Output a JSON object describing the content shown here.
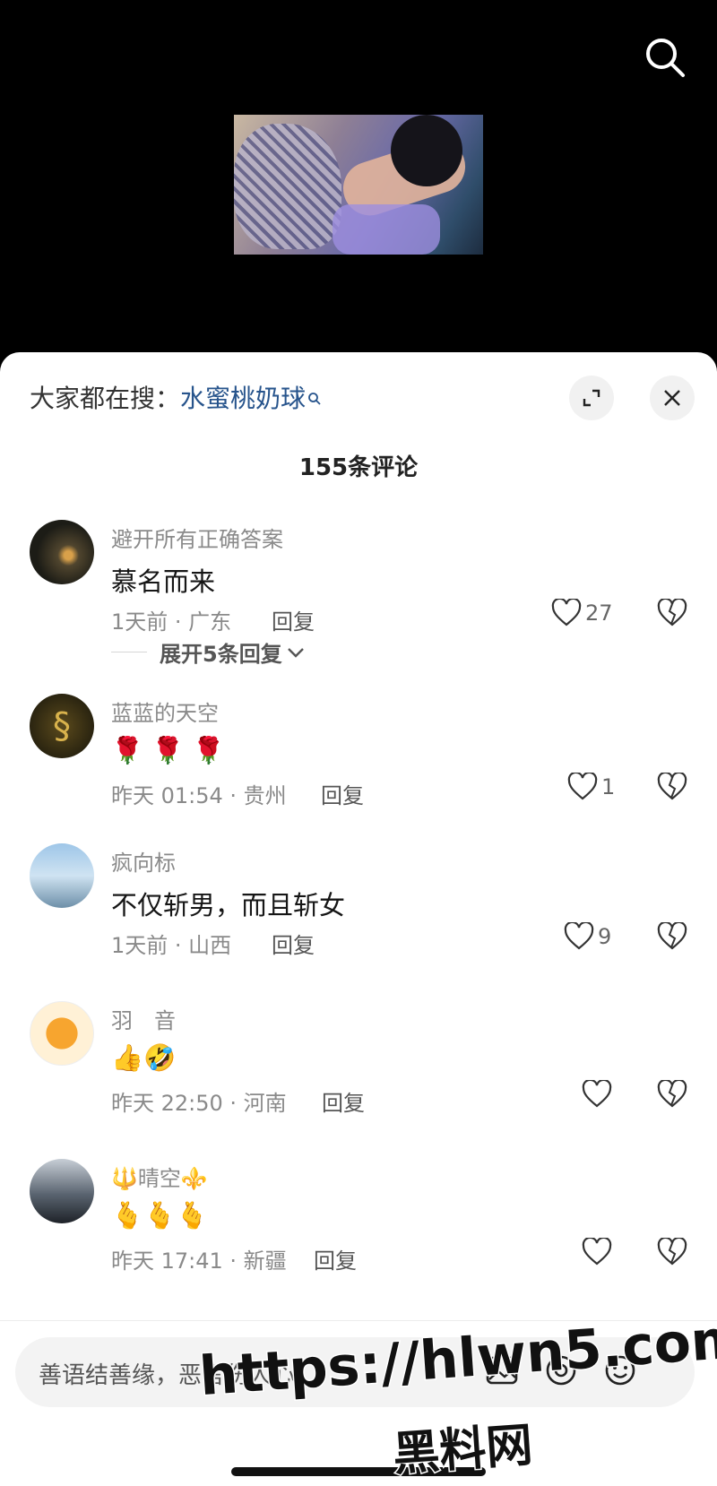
{
  "hot_search": {
    "prefix": "大家都在搜：",
    "keyword": "水蜜桃奶球"
  },
  "comment_count": "155条评论",
  "comments": [
    {
      "name": "避开所有正确答案",
      "text": "慕名而来",
      "time": "1天前 · 广东",
      "reply": "回复",
      "likes": "27"
    },
    {
      "name": "蓝蓝的天空",
      "text": "🌹 🌹 🌹",
      "time": "昨天 01:54 · 贵州",
      "reply": "回复",
      "likes": "1"
    },
    {
      "name": "疯向标",
      "text": "不仅斩男，而且斩女",
      "time": "1天前 · 山西",
      "reply": "回复",
      "likes": "9"
    },
    {
      "name": "羽　音",
      "text": "👍🤣",
      "time": "昨天 22:50 · 河南",
      "reply": "回复",
      "likes": ""
    },
    {
      "name": "🔱晴空⚜️",
      "text": "🫰🫰🫰",
      "time": "昨天 17:41 · 新疆",
      "reply": "回复",
      "likes": ""
    }
  ],
  "expand_replies": "展开5条回复",
  "input": {
    "placeholder": "善语结善缘，恶言伤人心"
  },
  "watermark": {
    "url": "https://hlwn5.com",
    "name": "黑料网"
  },
  "colors": {
    "keyword": "#27548c",
    "sheet": "#ffffff",
    "video_bg": "#000000"
  }
}
